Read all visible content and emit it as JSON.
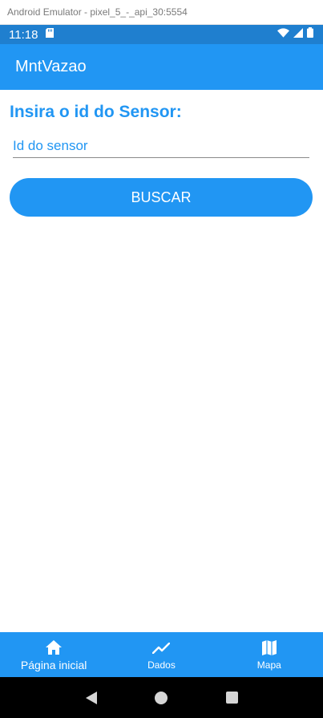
{
  "window": {
    "title": "Android Emulator - pixel_5_-_api_30:5554"
  },
  "status_bar": {
    "time": "11:18"
  },
  "app_bar": {
    "title": "MntVazao"
  },
  "main": {
    "heading": "Insira o id do Sensor:",
    "sensor_input": {
      "placeholder": "Id do sensor",
      "value": ""
    },
    "search_button": "BUSCAR"
  },
  "bottom_nav": {
    "items": [
      {
        "label": "Página inicial",
        "icon": "home-icon"
      },
      {
        "label": "Dados",
        "icon": "trending-up-icon"
      },
      {
        "label": "Mapa",
        "icon": "map-icon"
      }
    ]
  },
  "colors": {
    "status_bar": "#1f7fcf",
    "primary": "#2196f3",
    "system_nav": "#000000"
  }
}
